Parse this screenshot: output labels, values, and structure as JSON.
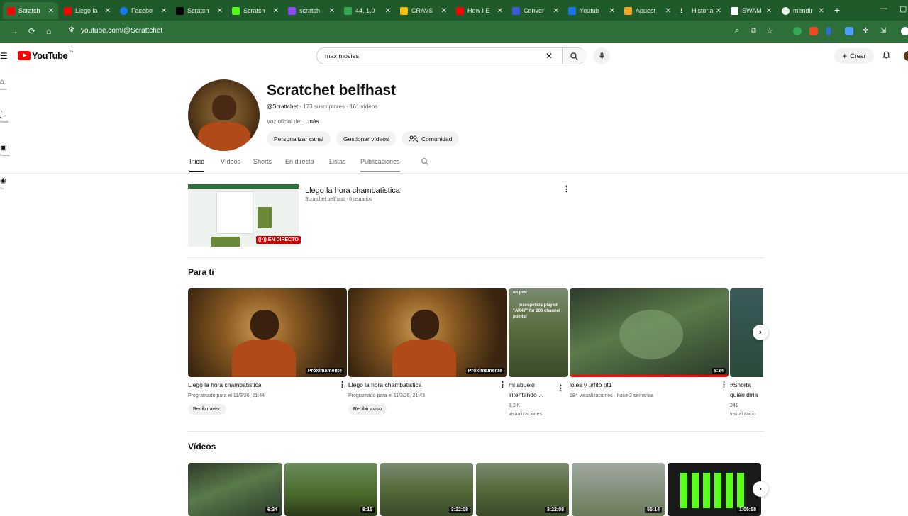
{
  "browser": {
    "tabs": [
      {
        "title": "Scratch",
        "color": "#ff0000"
      },
      {
        "title": "Llego la",
        "color": "#ff0000"
      },
      {
        "title": "Facebo",
        "color": "#1877f2"
      },
      {
        "title": "Scratch",
        "color": "#000000"
      },
      {
        "title": "Scratch",
        "color": "#53fc18"
      },
      {
        "title": "scratch",
        "color": "#9146ff"
      },
      {
        "title": "44, 1,0",
        "color": "#34a853"
      },
      {
        "title": "CRAVS",
        "color": "#fbbc04"
      },
      {
        "title": "How I E",
        "color": "#ff0000"
      },
      {
        "title": "Conver",
        "color": "#3b5bdb"
      },
      {
        "title": "Youtub",
        "color": "#1a73e8"
      },
      {
        "title": "Apuest",
        "color": "#f5a623"
      },
      {
        "title": "Historia",
        "color": "#ffffff"
      },
      {
        "title": "SWAM",
        "color": "#ffffff"
      },
      {
        "title": "mendir",
        "color": "#e8f0e8"
      }
    ],
    "url": "youtube.com/@Scrattchet"
  },
  "youtube": {
    "logo_text": "YouTube",
    "country_code": "VE",
    "search_value": "max movies",
    "create_label": "Crear"
  },
  "guide": [
    {
      "label": "Inicio",
      "icon": "home-icon"
    },
    {
      "label": "Shorts",
      "icon": "shorts-icon"
    },
    {
      "label": "Suscripciones",
      "icon": "subscriptions-icon"
    },
    {
      "label": "Tú",
      "icon": "you-icon"
    }
  ],
  "channel": {
    "name": "Scratchet belfhast",
    "handle": "@Scrattchet",
    "meta": " · 173 suscriptores · 161 vídeos",
    "desc_prefix": "Voz oficial de: ",
    "desc_more": "...más",
    "buttons": {
      "customize": "Personalizar canal",
      "manage": "Gestionar vídeos",
      "community": "Comunidad"
    },
    "tabs": [
      "Inicio",
      "Vídeos",
      "Shorts",
      "En directo",
      "Listas",
      "Publicaciones"
    ]
  },
  "featured": {
    "title": "Llego la hora chambatistica",
    "meta": "Scratchet belfhast · 6 usuarios",
    "badge": "EN DIRECTO"
  },
  "for_you": {
    "title": "Para ti",
    "videos": [
      {
        "title": "Llego la hora chambatistica",
        "meta": "Programado para el 11/3/26, 21:44",
        "badge": "Próximamente",
        "button": "Recibir aviso"
      },
      {
        "title": "Llego la hora chambatistica",
        "meta": "Programado para el 11/3/26, 21:43",
        "badge": "Próximamente",
        "button": "Recibir aviso"
      },
      {
        "title_line1": "mi abuelo",
        "title_line2": "intentando ...",
        "meta_line1": "1,3 K",
        "meta_line2": "visualizaciones",
        "overlay_line1": "en pwc",
        "overlay_line2": "josespelicia played",
        "overlay_line3": "\"AK47\" for 200 channel",
        "overlay_line4": "points!"
      },
      {
        "title": "loles y urfito pt1",
        "meta": "184 visualizaciones · hace 2 semanas",
        "duration": "6:34"
      },
      {
        "title_line1": "#Shorts",
        "title_line2": "quien diria",
        "meta_line1": "241",
        "meta_line2": "visualizacio"
      }
    ]
  },
  "videos_shelf": {
    "title": "Vídeos",
    "durations": [
      "6:34",
      "8:15",
      "3:22:08",
      "3:22:08",
      "55:14",
      "1:05:58"
    ]
  },
  "colors": {
    "brand_red": "#ff0000",
    "browser_green": "#2f6f3a",
    "live_red": "#cc0000"
  }
}
